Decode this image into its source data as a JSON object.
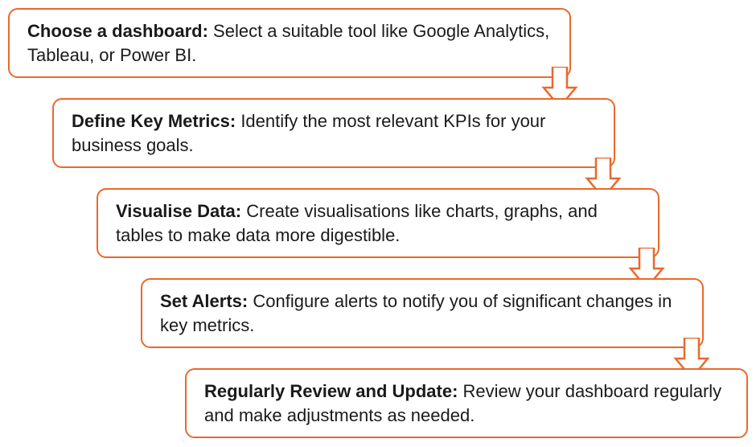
{
  "accent": "#e9692c",
  "steps": [
    {
      "title": "Choose a dashboard:",
      "body": "Select a suitable tool like Google Analytics, Tableau, or Power BI."
    },
    {
      "title": "Define Key Metrics:",
      "body": "Identify the most relevant KPIs for your business goals."
    },
    {
      "title": "Visualise Data:",
      "body": "Create visualisations like charts, graphs, and tables to make data more digestible."
    },
    {
      "title": "Set Alerts:",
      "body": "Configure alerts to notify you of significant changes in key metrics."
    },
    {
      "title": "Regularly Review and Update:",
      "body": "Review your dashboard regularly and make adjustments as needed."
    }
  ]
}
